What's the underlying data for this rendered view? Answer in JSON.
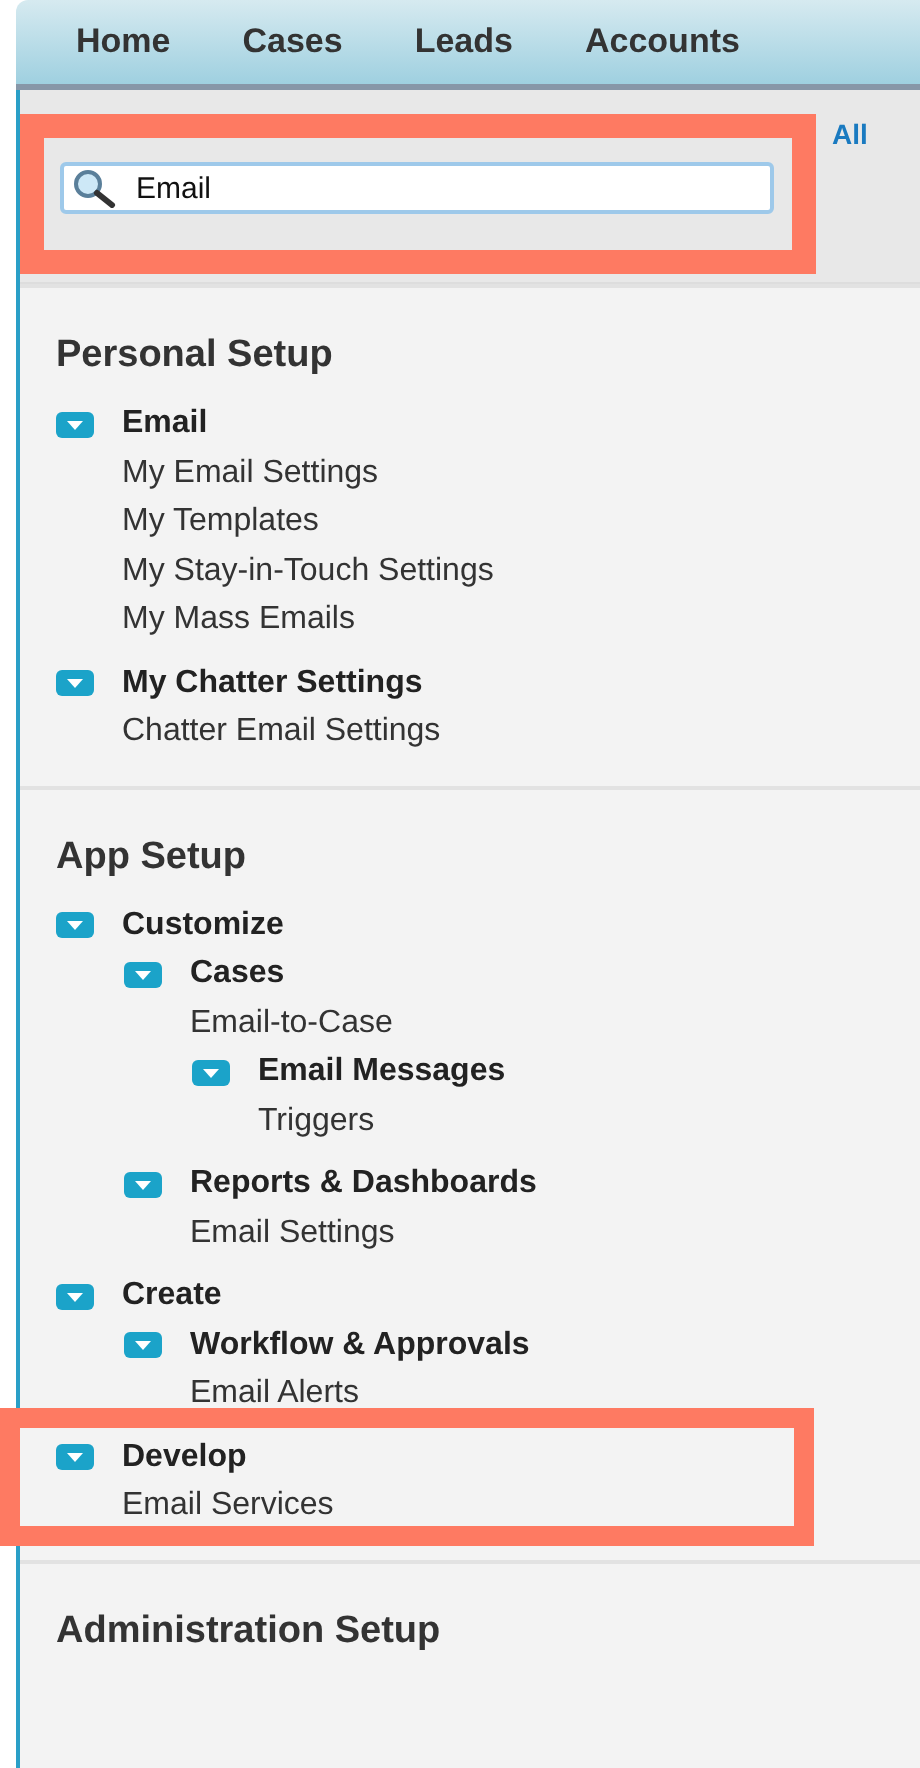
{
  "tabs": [
    {
      "label": "Home"
    },
    {
      "label": "Cases"
    },
    {
      "label": "Leads"
    },
    {
      "label": "Accounts"
    }
  ],
  "toggle_links": {
    "label": "All"
  },
  "search": {
    "value": "Email",
    "highlighted": true
  },
  "sections": [
    {
      "title": "Personal Setup",
      "items": [
        {
          "kind": "group",
          "label": "Email",
          "expanded": true,
          "highlighted": false,
          "children": [
            {
              "kind": "link",
              "label": "My Email Settings"
            },
            {
              "kind": "link",
              "label": "My Templates"
            },
            {
              "kind": "link",
              "label": "My Stay-in-Touch Settings"
            },
            {
              "kind": "link",
              "label": "My Mass Emails"
            }
          ]
        },
        {
          "kind": "group",
          "label": "My Chatter Settings",
          "expanded": true,
          "highlighted": false,
          "children": [
            {
              "kind": "link",
              "label": "Chatter Email Settings"
            }
          ]
        }
      ]
    },
    {
      "title": "App Setup",
      "items": [
        {
          "kind": "group",
          "label": "Customize",
          "expanded": true,
          "highlighted": false,
          "children": [
            {
              "kind": "group",
              "label": "Cases",
              "expanded": true,
              "highlighted": false,
              "children": [
                {
                  "kind": "link",
                  "label": "Email-to-Case"
                },
                {
                  "kind": "group",
                  "label": "Email Messages",
                  "expanded": true,
                  "highlighted": false,
                  "children": [
                    {
                      "kind": "link",
                      "label": "Triggers"
                    }
                  ]
                }
              ]
            },
            {
              "kind": "group",
              "label": "Reports & Dashboards",
              "expanded": true,
              "highlighted": false,
              "children": [
                {
                  "kind": "link",
                  "label": "Email Settings"
                }
              ]
            }
          ]
        },
        {
          "kind": "group",
          "label": "Create",
          "expanded": true,
          "highlighted": false,
          "children": [
            {
              "kind": "group",
              "label": "Workflow & Approvals",
              "expanded": true,
              "highlighted": false,
              "children": [
                {
                  "kind": "link",
                  "label": "Email Alerts"
                }
              ]
            }
          ]
        },
        {
          "kind": "group",
          "label": "Develop",
          "expanded": true,
          "highlighted": true,
          "children": [
            {
              "kind": "link",
              "label": "Email Services"
            }
          ]
        }
      ]
    },
    {
      "title": "Administration Setup"
    }
  ]
}
